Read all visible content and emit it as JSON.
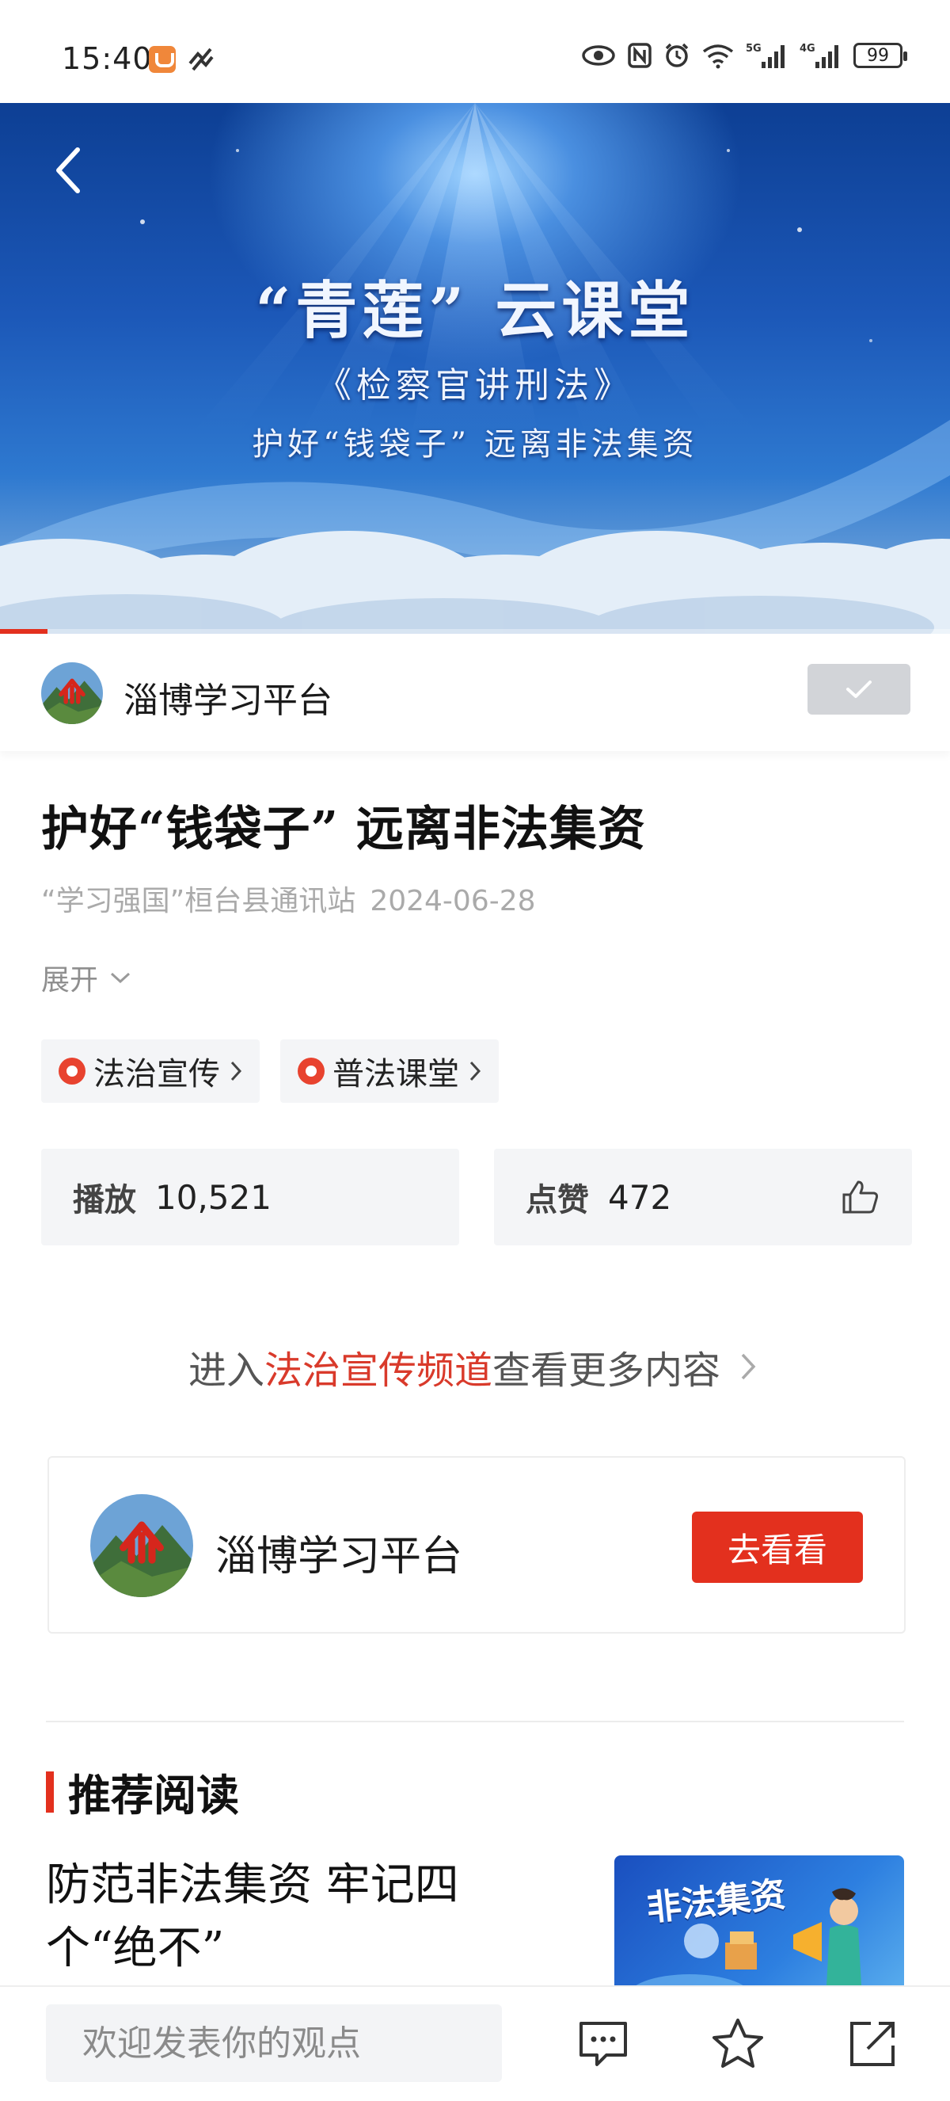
{
  "status_bar": {
    "time": "15:40",
    "battery": "99",
    "network_1": "5G",
    "network_2": "4G"
  },
  "video": {
    "title": "“青莲” 云课堂",
    "subtitle": "《检察官讲刑法》",
    "topic": "护好“钱袋子” 远离非法集资",
    "progress_percent": 5
  },
  "author": {
    "name": "淄博学习平台",
    "followed": true
  },
  "article": {
    "title": "护好“钱袋子” 远离非法集资",
    "source": "“学习强国”桓台县通讯站",
    "date": "2024-06-28",
    "expand_label": "展开"
  },
  "tags": [
    {
      "label": "法治宣传"
    },
    {
      "label": "普法课堂"
    }
  ],
  "stats": {
    "play_label": "播放",
    "play_value": "10,521",
    "like_label": "点赞",
    "like_value": "472"
  },
  "channel_link": {
    "prefix": "进入",
    "channel": "法治宣传频道",
    "suffix": "查看更多内容"
  },
  "platform_card": {
    "name": "淄博学习平台",
    "button": "去看看"
  },
  "recommended": {
    "heading": "推荐阅读",
    "items": [
      {
        "title": "防范非法集资 牢记四个“绝不”",
        "thumb_text": "非法集资"
      }
    ]
  },
  "bottom_bar": {
    "comment_placeholder": "欢迎发表你的观点"
  },
  "colors": {
    "accent": "#e3301e",
    "banner_blue": "#1c58b8",
    "muted_text": "#aaaaaa"
  },
  "icons": [
    "back-icon",
    "check-icon",
    "chevron-down-icon",
    "tag-location-icon",
    "chevron-right-icon",
    "thumbs-up-icon",
    "comment-icon",
    "star-icon",
    "share-icon"
  ]
}
